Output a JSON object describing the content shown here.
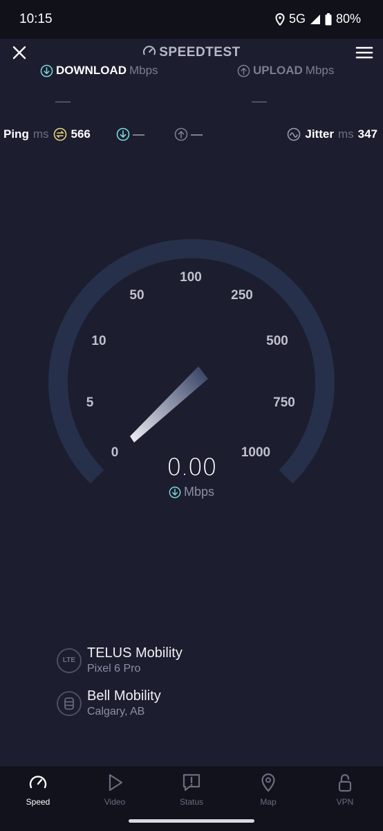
{
  "status_bar": {
    "time": "10:15",
    "network": "5G",
    "battery": "80%"
  },
  "header": {
    "title": "SPEEDTEST"
  },
  "metrics": {
    "download": {
      "label": "DOWNLOAD",
      "unit": "Mbps",
      "value": "—"
    },
    "upload": {
      "label": "UPLOAD",
      "unit": "Mbps",
      "value": "—"
    }
  },
  "ping": {
    "label": "Ping",
    "unit": "ms",
    "value": "566",
    "download_value": "—",
    "upload_value": "—"
  },
  "jitter": {
    "label": "Jitter",
    "unit": "ms",
    "value": "347"
  },
  "gauge": {
    "labels": [
      "0",
      "5",
      "10",
      "50",
      "100",
      "250",
      "500",
      "750",
      "1000"
    ],
    "speed": "0.00",
    "unit": "Mbps"
  },
  "connection": {
    "provider": "TELUS Mobility",
    "device": "Pixel 6 Pro",
    "provider_badge": "LTE",
    "server": "Bell Mobility",
    "server_location": "Calgary, AB"
  },
  "nav": {
    "items": [
      {
        "label": "Speed",
        "icon": "speed-gauge-icon",
        "active": true
      },
      {
        "label": "Video",
        "icon": "play-icon",
        "active": false
      },
      {
        "label": "Status",
        "icon": "alert-icon",
        "active": false
      },
      {
        "label": "Map",
        "icon": "map-pin-icon",
        "active": false
      },
      {
        "label": "VPN",
        "icon": "lock-open-icon",
        "active": false
      }
    ]
  },
  "colors": {
    "background": "#1c1d2e",
    "gauge_track": "#26304a",
    "accent_cyan": "#7ad9e0",
    "ping_yellow": "#e8d47a"
  }
}
